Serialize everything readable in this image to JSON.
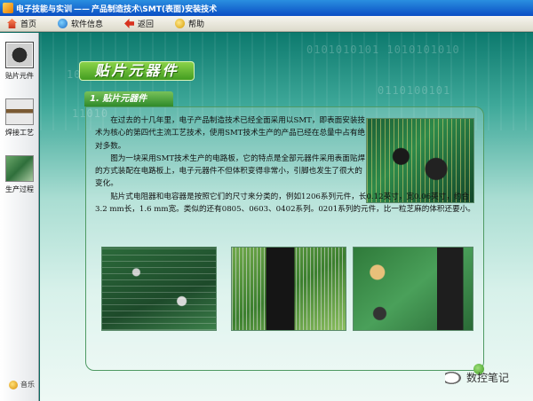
{
  "window": {
    "title_left": "电子技能与实训",
    "title_dash": "——",
    "title_right": "产品制造技术\\SMT(表面)安装技术"
  },
  "toolbar": {
    "home": "首页",
    "info": "软件信息",
    "back": "返回",
    "help": "帮助"
  },
  "sidebar": {
    "items": [
      {
        "label": "贴片元件",
        "icon": "chip-icon"
      },
      {
        "label": "焊接工艺",
        "icon": "solder-icon"
      },
      {
        "label": "生产过程",
        "icon": "production-icon"
      }
    ],
    "music": "音乐"
  },
  "main": {
    "banner_title": "贴片元器件",
    "section_title": "1. 贴片元器件",
    "paragraphs": [
      "在过去的十几年里，电子产品制造技术已经全面采用以SMT，即表面安装技术为核心的第四代主流工艺技术，使用SMT技术生产的产品已经在总量中占有绝对多数。",
      "图为一块采用SMT技术生产的电路板，它的特点是全部元器件采用表面贴焊的方式装配在电路板上，电子元器件不但体积变得非常小，引脚也发生了很大的变化。",
      "贴片式电阻器和电容器是按照它们的尺寸来分类的，例如1206系列元件，长0.12英寸，宽0.06英寸，约合3.2 mm长，1.6 mm宽。类似的还有0805、0603、0402系列。0201系列的元件，比一粒芝麻的体积还要小。"
    ]
  },
  "watermark": "数控笔记",
  "colors": {
    "titlebar": "#0a4ec4",
    "banner": "#5cb82c",
    "panel_border": "#4f9a63"
  }
}
